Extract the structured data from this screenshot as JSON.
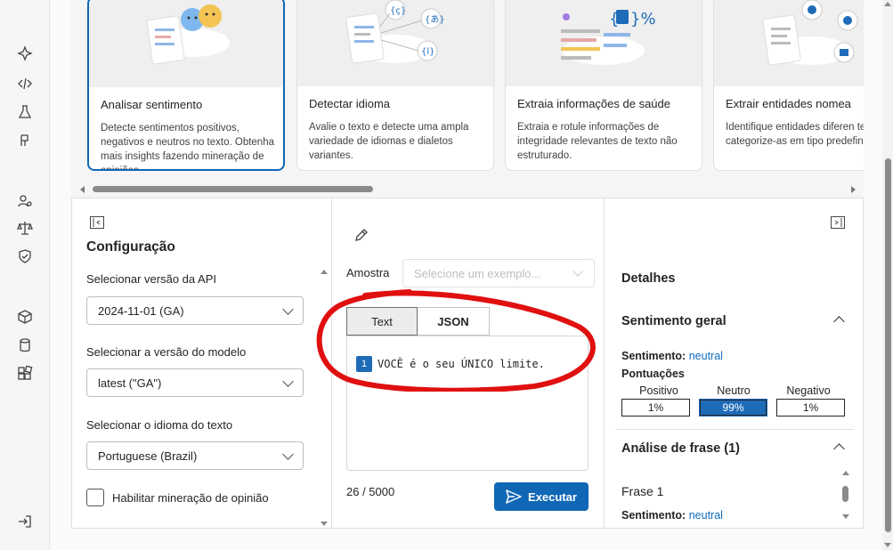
{
  "sidebar": {
    "icons": [
      "sparkle-icon",
      "code-icon",
      "flask-icon",
      "tag-icon",
      "person-settings-icon",
      "scales-icon",
      "shield-icon",
      "cube-icon",
      "database-icon",
      "apps-icon",
      "sign-in-icon"
    ]
  },
  "cards": [
    {
      "title": "Analisar sentimento",
      "description": "Detecte sentimentos positivos, negativos e neutros no texto. Obtenha mais insights fazendo mineração de opiniões.",
      "selected": true
    },
    {
      "title": "Detectar idioma",
      "description": "Avalie o texto e detecte uma ampla variedade de idiomas e dialetos variantes.",
      "selected": false
    },
    {
      "title": "Extraia informações de saúde",
      "description": "Extraia e rotule informações de integridade relevantes de texto não estruturado.",
      "selected": false
    },
    {
      "title": "Extrair entidades nomea",
      "description": "Identifique entidades diferen texto e categorize-as em tipo predefinidos.",
      "selected": false
    }
  ],
  "config": {
    "title": "Configuração",
    "api_label": "Selecionar versão da API",
    "api_value": "2024-11-01 (GA)",
    "model_label": "Selecionar a versão do modelo",
    "model_value": "latest (\"GA\")",
    "lang_label": "Selecionar o idioma do texto",
    "lang_value": "Portuguese (Brazil)",
    "opinion_label": "Habilitar mineração de opinião"
  },
  "input": {
    "sample_label": "Amostra",
    "sample_placeholder": "Selecione um exemplo...",
    "tab_text": "Text",
    "tab_json": "JSON",
    "line_number": "1",
    "text": "VOCÊ é o seu ÚNICO limite.",
    "counter": "26 / 5000",
    "run_label": "Executar"
  },
  "details": {
    "title": "Detalhes",
    "overall_title": "Sentimento geral",
    "sentiment_label": "Sentimento:",
    "sentiment_value": "neutral",
    "scores_label": "Pontuações",
    "score_headers": [
      "Positivo",
      "Neutro",
      "Negativo"
    ],
    "score_values": [
      "1%",
      "99%",
      "1%"
    ],
    "sentence_title": "Análise de frase (1)",
    "sentence_name": "Frase 1",
    "sentence_sentiment_label": "Sentimento:",
    "sentence_sentiment_value": "neutral"
  },
  "colors": {
    "accent": "#1067b6",
    "annotation": "#e01010"
  }
}
